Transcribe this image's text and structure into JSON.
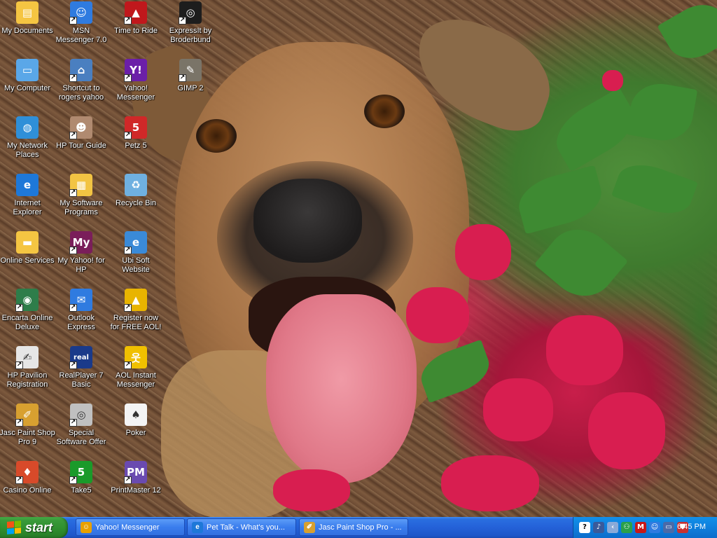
{
  "desktop_icons": [
    {
      "name": "my-documents-icon",
      "label": "My Documents",
      "shortcut": false,
      "color": "#f5c542",
      "glyph": "▤"
    },
    {
      "name": "msn-messenger-icon",
      "label": "MSN Messenger 7.0",
      "shortcut": true,
      "color": "#2f7be0",
      "glyph": "☺"
    },
    {
      "name": "time-to-ride-icon",
      "label": "Time to Ride",
      "shortcut": true,
      "color": "#c0181c",
      "glyph": "▲"
    },
    {
      "name": "expressit-icon",
      "label": "ExpressIt by Broderbund",
      "shortcut": true,
      "color": "#1d1d1d",
      "glyph": "◎"
    },
    {
      "name": "my-computer-icon",
      "label": "My Computer",
      "shortcut": false,
      "color": "#5aa7e8",
      "glyph": "▭"
    },
    {
      "name": "shortcut-rogers-yahoo-icon",
      "label": "Shortcut to rogers yahoo",
      "shortcut": true,
      "color": "#4a7fc0",
      "glyph": "⌂"
    },
    {
      "name": "yahoo-messenger-icon",
      "label": "Yahoo! Messenger",
      "shortcut": true,
      "color": "#6b1fa8",
      "glyph": "Y!"
    },
    {
      "name": "gimp-icon",
      "label": "GIMP 2",
      "shortcut": true,
      "color": "#7a7468",
      "glyph": "✎"
    },
    {
      "name": "my-network-places-icon",
      "label": "My Network Places",
      "shortcut": false,
      "color": "#2f8fd8",
      "glyph": "◍"
    },
    {
      "name": "hp-tour-guide-icon",
      "label": "HP Tour Guide",
      "shortcut": true,
      "color": "#b08a70",
      "glyph": "☻"
    },
    {
      "name": "petz-icon",
      "label": "Petz 5",
      "shortcut": true,
      "color": "#d02828",
      "glyph": "5"
    },
    {
      "name": "internet-explorer-icon",
      "label": "Internet Explorer",
      "shortcut": false,
      "color": "#1e78d8",
      "glyph": "e"
    },
    {
      "name": "my-software-programs-icon",
      "label": "My Software Programs",
      "shortcut": true,
      "color": "#f2c443",
      "glyph": "▦"
    },
    {
      "name": "recycle-bin-icon",
      "label": "Recycle Bin",
      "shortcut": false,
      "color": "#6fb0e0",
      "glyph": "♻"
    },
    {
      "name": "online-services-icon",
      "label": "Online Services",
      "shortcut": false,
      "color": "#f5c542",
      "glyph": "▬"
    },
    {
      "name": "my-yahoo-for-hp-icon",
      "label": "My Yahoo! for HP",
      "shortcut": true,
      "color": "#7a1e5a",
      "glyph": "My"
    },
    {
      "name": "ubi-soft-website-icon",
      "label": "Ubi Soft Website",
      "shortcut": true,
      "color": "#3a8ad8",
      "glyph": "e"
    },
    {
      "name": "encarta-online-deluxe-icon",
      "label": "Encarta Online Deluxe",
      "shortcut": true,
      "color": "#2e7d4a",
      "glyph": "◉"
    },
    {
      "name": "outlook-express-icon",
      "label": "Outlook Express",
      "shortcut": true,
      "color": "#2f7be0",
      "glyph": "✉"
    },
    {
      "name": "register-aol-icon",
      "label": "Register now for FREE AOL!",
      "shortcut": true,
      "color": "#e8b400",
      "glyph": "▲"
    },
    {
      "name": "hp-pavilion-registration-icon",
      "label": "HP Pavilion Registration",
      "shortcut": true,
      "color": "#e6e6e6",
      "glyph": "✍"
    },
    {
      "name": "realplayer-icon",
      "label": "RealPlayer 7 Basic",
      "shortcut": true,
      "color": "#1a3a8a",
      "glyph": "real"
    },
    {
      "name": "aol-instant-messenger-icon",
      "label": "AOL Instant Messenger",
      "shortcut": true,
      "color": "#f0c000",
      "glyph": "웃"
    },
    {
      "name": "jasc-paint-shop-pro-icon",
      "label": "Jasc Paint Shop Pro 9",
      "shortcut": true,
      "color": "#d8a030",
      "glyph": "✐"
    },
    {
      "name": "special-software-offer-icon",
      "label": "Special Software Offer",
      "shortcut": true,
      "color": "#c0c0c0",
      "glyph": "◎"
    },
    {
      "name": "poker-icon",
      "label": "Poker",
      "shortcut": false,
      "color": "#f4f4f4",
      "glyph": "♠"
    },
    {
      "name": "casino-online-icon",
      "label": "Casino Online",
      "shortcut": true,
      "color": "#d84a2a",
      "glyph": "♦"
    },
    {
      "name": "take5-icon",
      "label": "Take5",
      "shortcut": true,
      "color": "#1a9a2a",
      "glyph": "5"
    },
    {
      "name": "printmaster-icon",
      "label": "PrintMaster 12",
      "shortcut": true,
      "color": "#6a4ab0",
      "glyph": "PM"
    }
  ],
  "taskbar": {
    "start_label": "start",
    "tasks": [
      {
        "name": "task-yahoo-messenger",
        "label": "Yahoo! Messenger",
        "icon": "yahoo-icon",
        "color": "#e8a000",
        "glyph": "☺"
      },
      {
        "name": "task-pet-talk",
        "label": "Pet Talk - What's you...",
        "icon": "ie-icon",
        "color": "#1e78d8",
        "glyph": "e"
      },
      {
        "name": "task-jasc-paint-shop-pro",
        "label": "Jasc Paint Shop Pro - ...",
        "icon": "paint-icon",
        "color": "#d8a030",
        "glyph": "✐"
      }
    ],
    "tray_icons": [
      {
        "name": "help-icon",
        "glyph": "?",
        "color": "#ffffff"
      },
      {
        "name": "volume-icon",
        "glyph": "♪",
        "color": "#3a5a9a"
      },
      {
        "name": "chevron-left-icon",
        "glyph": "‹",
        "color": "#8aaad8"
      },
      {
        "name": "network-icon",
        "glyph": "⚇",
        "color": "#2aa04a"
      },
      {
        "name": "mcafee-icon",
        "glyph": "M",
        "color": "#c81818"
      },
      {
        "name": "msn-tray-icon",
        "glyph": "☺",
        "color": "#2f7be0"
      },
      {
        "name": "monitor-icon",
        "glyph": "▭",
        "color": "#4a6aa8"
      },
      {
        "name": "shield-icon",
        "glyph": "⛊",
        "color": "#c83030"
      }
    ],
    "clock": "6:45 PM"
  }
}
